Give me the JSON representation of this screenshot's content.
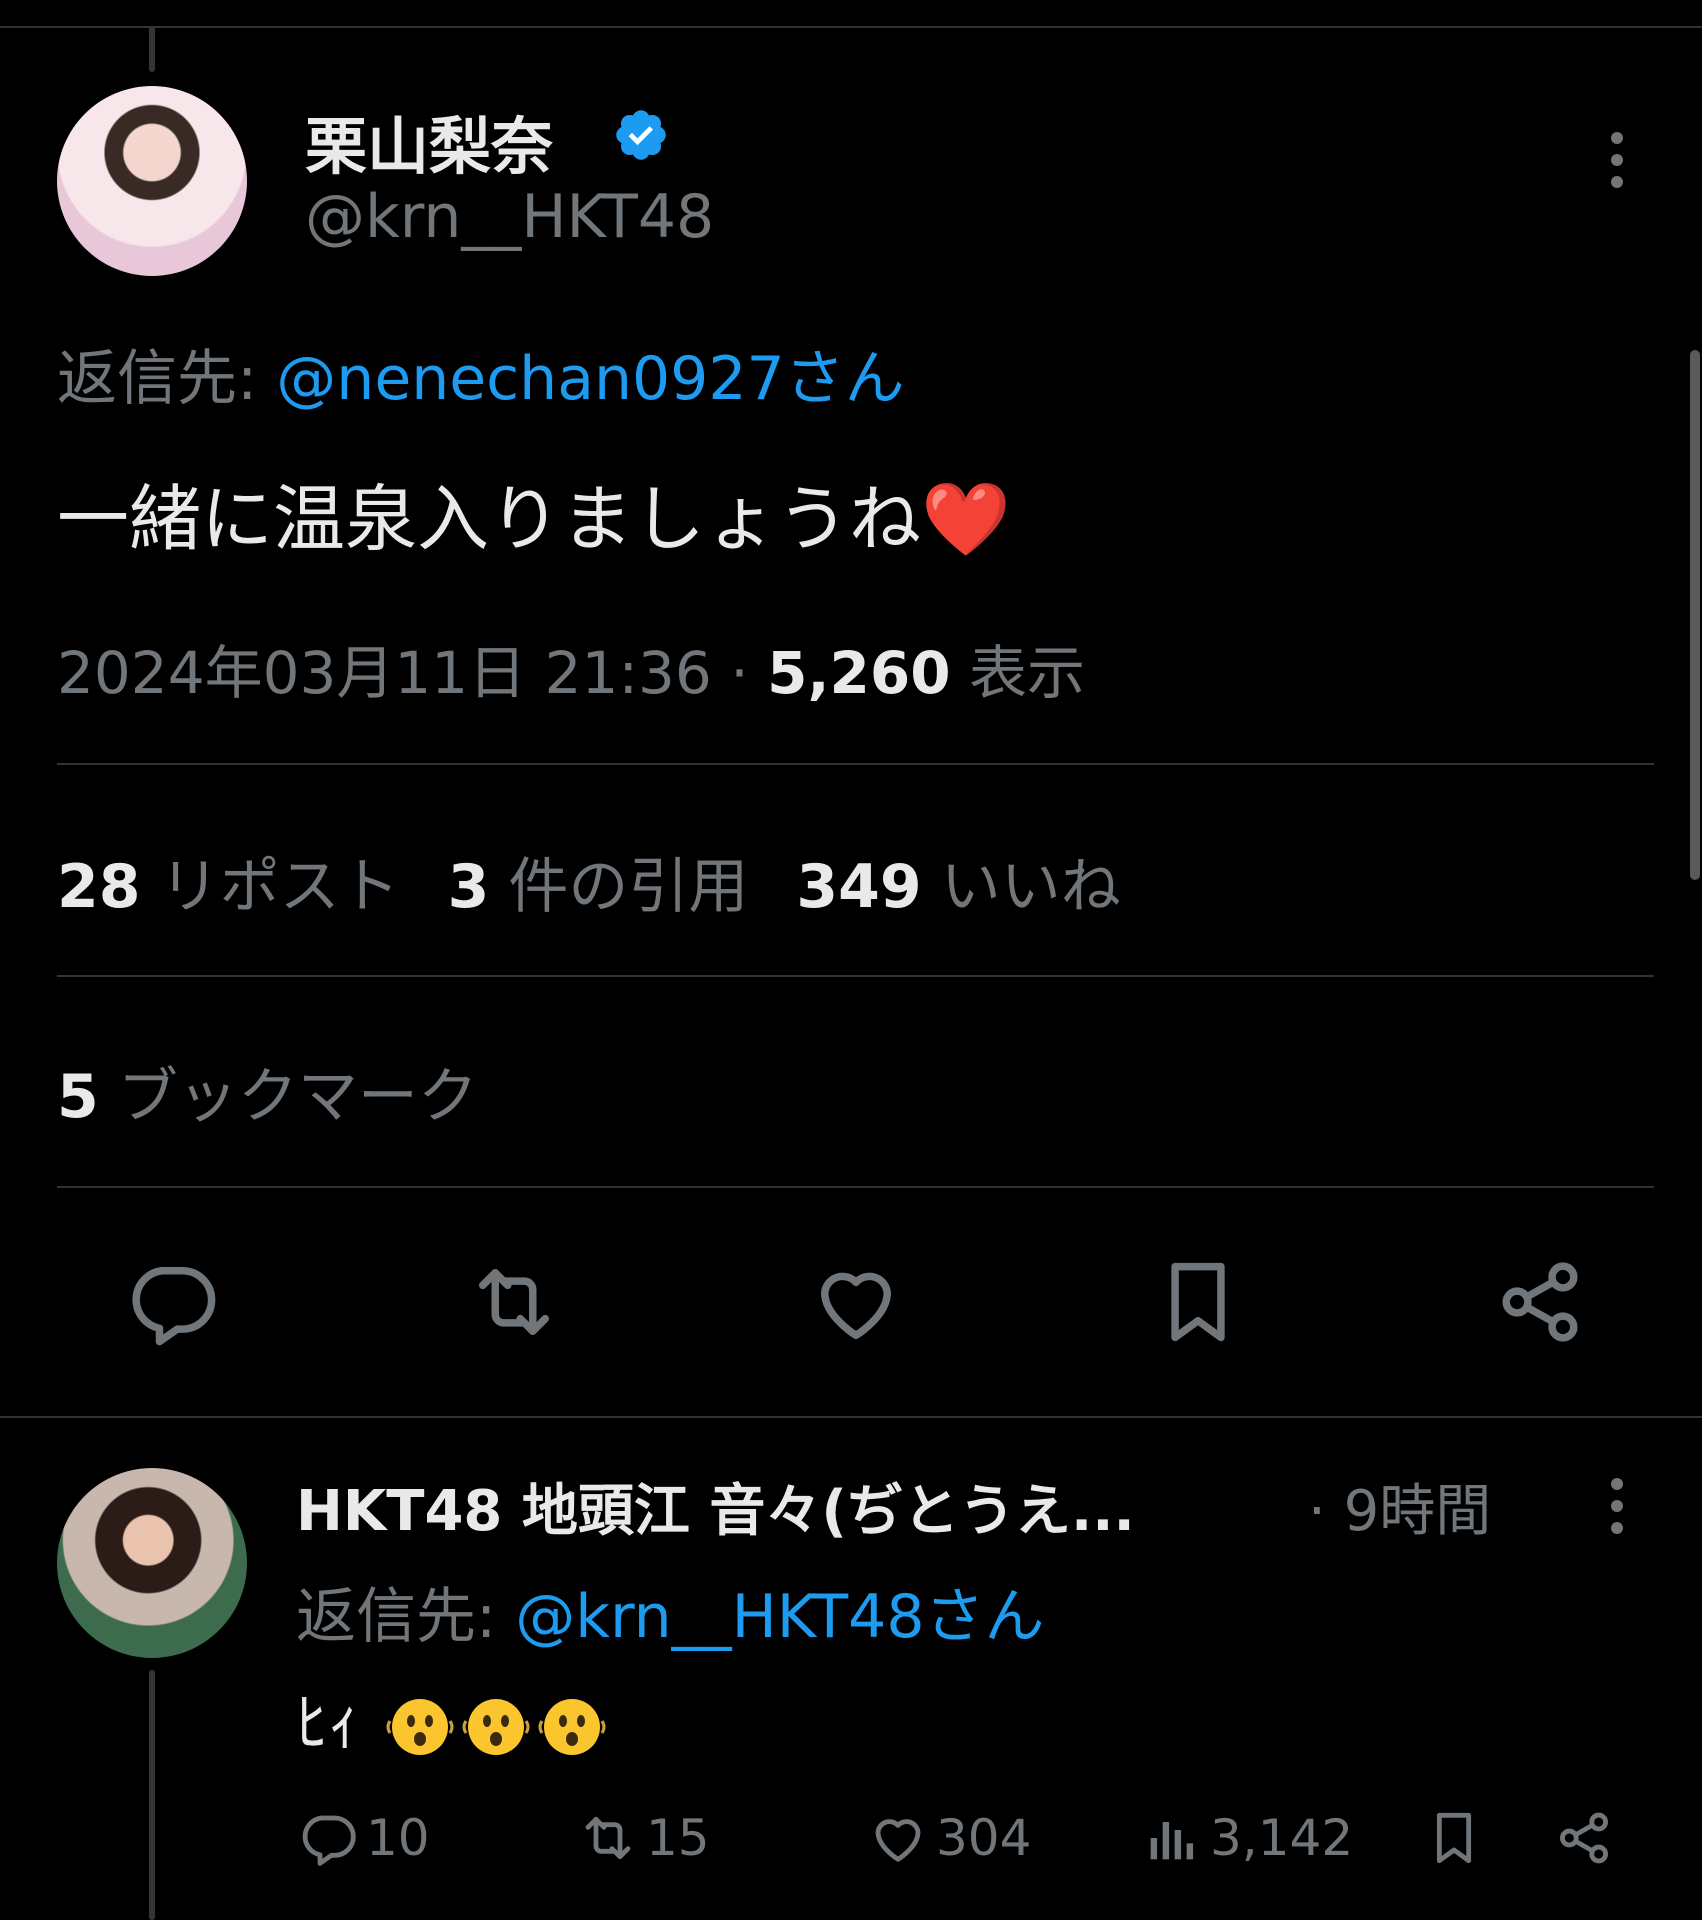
{
  "tweet": {
    "display_name": "栗山梨奈",
    "handle": "@krn__HKT48",
    "reply_prefix": "返信先: ",
    "reply_to": "@nenechan0927さん",
    "text": "一緒に温泉入りましょうね",
    "text_emoji": "❤️",
    "date": "2024年03月11日 21:36",
    "dot": " · ",
    "views_count": "5,260",
    "views_label": " 表示",
    "reposts_count": "28",
    "reposts_label": " リポスト",
    "quotes_count": "3",
    "quotes_label": " 件の引用",
    "likes_count": "349",
    "likes_label": " いいね",
    "bookmarks_count": "5",
    "bookmarks_label": " ブックマーク"
  },
  "reply": {
    "display_name": "HKT48 地頭江 音々(ぢとうえ...",
    "time": "· 9時間",
    "reply_prefix": "返信先: ",
    "reply_to": "@krn__HKT48さん",
    "text": "ﾋｨ",
    "emoji_name": "shaking-face-emoji",
    "reply_count": "10",
    "repost_count": "15",
    "like_count": "304",
    "view_count": "3,142"
  },
  "colors": {
    "background": "#000000",
    "text": "#e7e9ea",
    "secondary": "#71767b",
    "accent": "#1d9bf0",
    "divider": "#2f3336"
  },
  "icons": [
    "verified-badge-icon",
    "more-icon",
    "reply-icon",
    "retweet-icon",
    "like-icon",
    "bookmark-icon",
    "share-icon",
    "views-icon"
  ]
}
